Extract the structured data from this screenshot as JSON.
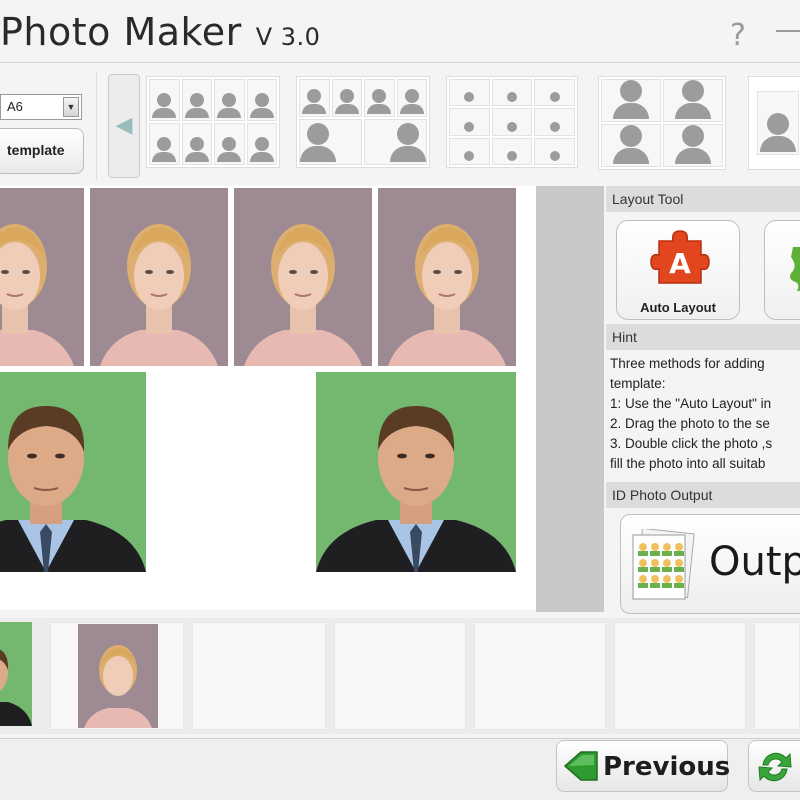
{
  "app": {
    "title": "Photo Maker",
    "version": "V 3.0",
    "help_label": "?"
  },
  "template": {
    "paper_size": "A6",
    "button_label": "template"
  },
  "panels": {
    "layout_tool": {
      "title": "Layout Tool",
      "buttons": [
        {
          "label": "Auto Layout"
        },
        {
          "label": ""
        }
      ]
    },
    "hint": {
      "title": "Hint",
      "lines": [
        "Three methods for adding",
        "template:",
        "1: Use the \"Auto Layout\" in",
        "2. Drag the photo to the se",
        "3. Double click the photo ,s",
        "fill the photo into all suitab"
      ]
    },
    "output": {
      "title": "ID Photo Output",
      "button_label": "Outp"
    }
  },
  "footer": {
    "previous_label": "Previous"
  },
  "colors": {
    "woman_bg": "#9d8a92",
    "man_bg": "#74b870",
    "panel_header": "#dcdcdc",
    "previous_accent": "#2f9a2f"
  }
}
